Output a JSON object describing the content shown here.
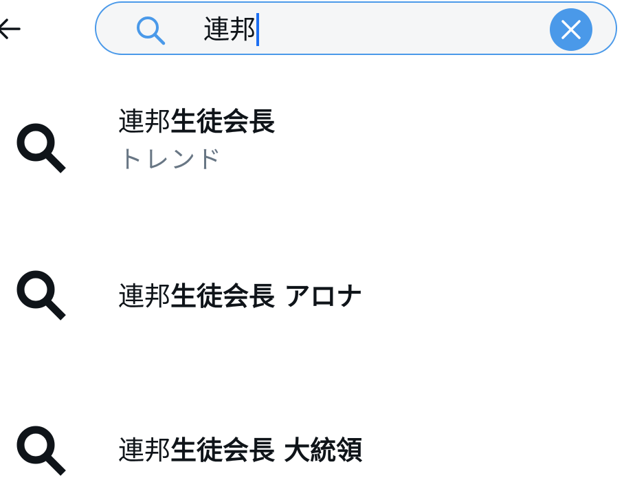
{
  "header": {
    "back_icon": "arrow-left-icon",
    "search": {
      "icon": "search-icon",
      "value": "連邦",
      "clear_icon": "close-icon"
    },
    "accent_color": "#4a99e9"
  },
  "suggestions": [
    {
      "icon": "search-icon",
      "typed": "連邦",
      "completion": "生徒会長",
      "subtitle": "トレンド"
    },
    {
      "icon": "search-icon",
      "typed": "連邦",
      "completion": "生徒会長 アロナ"
    },
    {
      "icon": "search-icon",
      "typed": "連邦",
      "completion": "生徒会長 大統領"
    }
  ]
}
